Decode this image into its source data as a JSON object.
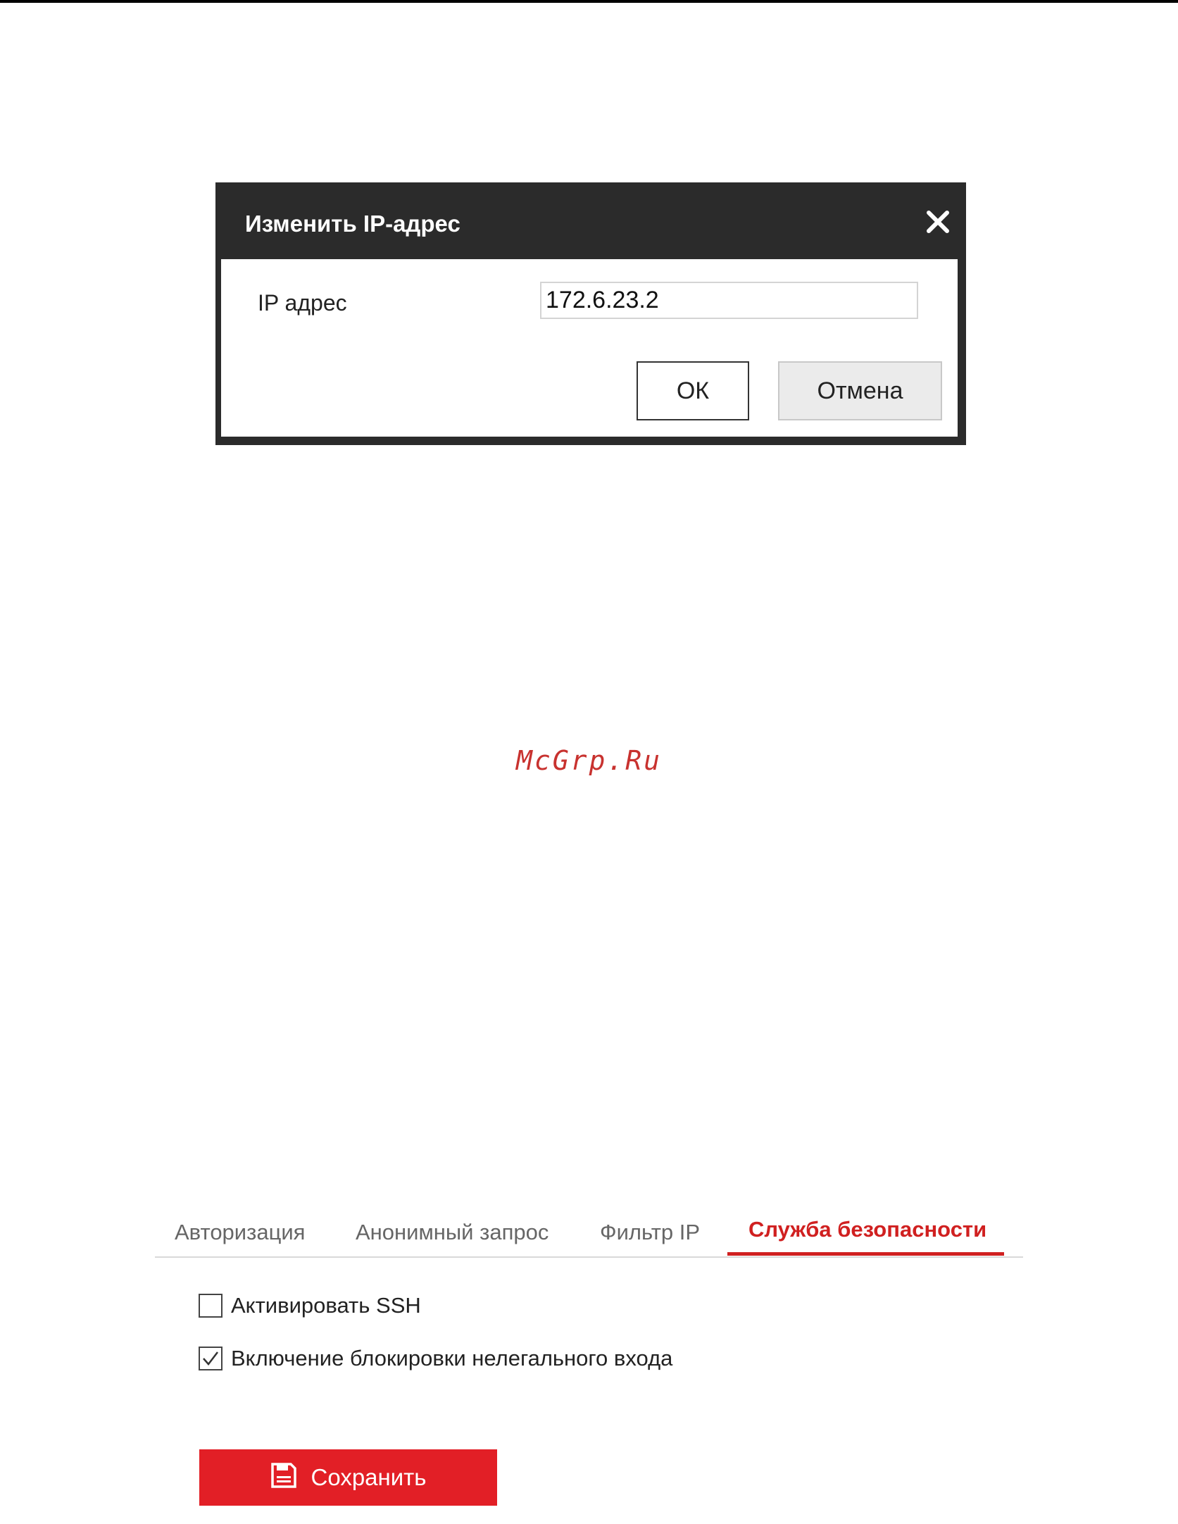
{
  "dialog": {
    "title": "Изменить IP-адрес",
    "ip_label": "IP адрес",
    "ip_value": "172.6.23.2",
    "ok_label": "ОК",
    "cancel_label": "Отмена"
  },
  "watermark": "McGrp.Ru",
  "security": {
    "tabs": [
      {
        "label": "Авторизация",
        "active": false
      },
      {
        "label": "Анонимный запрос",
        "active": false
      },
      {
        "label": "Фильтр IP",
        "active": false
      },
      {
        "label": "Служба безопасности",
        "active": true
      }
    ],
    "options": [
      {
        "label": "Активировать SSH",
        "checked": false
      },
      {
        "label": "Включение блокировки нелегального входа",
        "checked": true
      }
    ],
    "save_label": "Сохранить"
  },
  "colors": {
    "accent": "#d02020",
    "save_button": "#e21f26",
    "dialog_frame": "#2b2b2b"
  },
  "icons": [
    "close-icon",
    "checkmark-icon",
    "floppy-disk-icon"
  ]
}
